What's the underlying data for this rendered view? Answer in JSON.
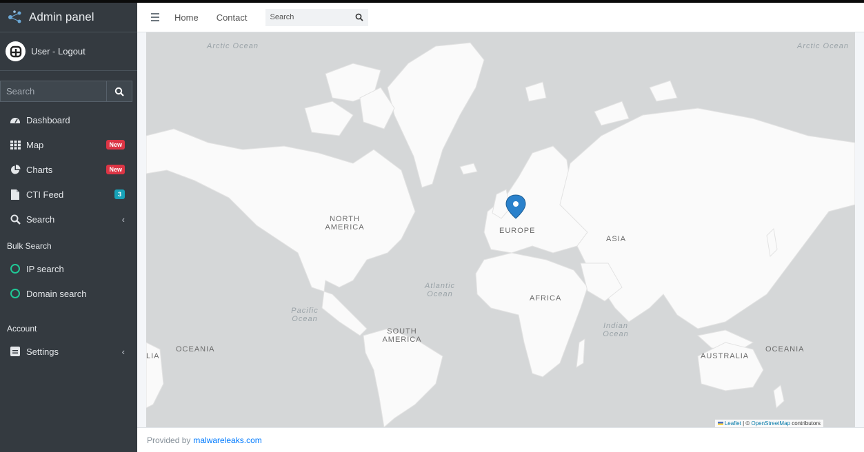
{
  "brand": {
    "title": "Admin panel"
  },
  "user": {
    "label": "User - Logout"
  },
  "sidebar": {
    "search_placeholder": "Search",
    "items": [
      {
        "label": "Dashboard",
        "icon": "dashboard-icon"
      },
      {
        "label": "Map",
        "icon": "grid-icon",
        "badge": "New"
      },
      {
        "label": "Charts",
        "icon": "pie-chart-icon",
        "badge": "New"
      },
      {
        "label": "CTI Feed",
        "icon": "file-icon",
        "badge": "3"
      },
      {
        "label": "Search",
        "icon": "search-icon"
      }
    ],
    "section_bulk": "Bulk Search",
    "bulk_items": [
      {
        "label": "IP search"
      },
      {
        "label": "Domain search"
      }
    ],
    "section_account": "Account",
    "account_items": [
      {
        "label": "Settings",
        "icon": "settings-icon"
      }
    ]
  },
  "navbar": {
    "links": [
      "Home",
      "Contact"
    ],
    "search_placeholder": "Search"
  },
  "map": {
    "labels": {
      "arctic": "Arctic Ocean",
      "north_america": "NORTH AMERICA",
      "europe": "EUROPE",
      "asia": "ASIA",
      "africa": "AFRICA",
      "south_america": "SOUTH AMERICA",
      "australia": "AUSTRALIA",
      "oceania": "OCEANIA",
      "atlantic": "Atlantic Ocean",
      "pacific": "Pacific Ocean",
      "indian": "Indian Ocean",
      "lia": "LIA"
    },
    "attribution": {
      "leaflet": "Leaflet",
      "sep": " | © ",
      "osm": "OpenStreetMap",
      "tail": " contributors"
    }
  },
  "footer": {
    "text": "Provided by",
    "link": "malwareleaks.com"
  },
  "colors": {
    "sidebar": "#343a40",
    "badge_red": "#dc3545",
    "badge_teal": "#17a2b8",
    "marker": "#2a81cb",
    "circle": "#20c997"
  }
}
